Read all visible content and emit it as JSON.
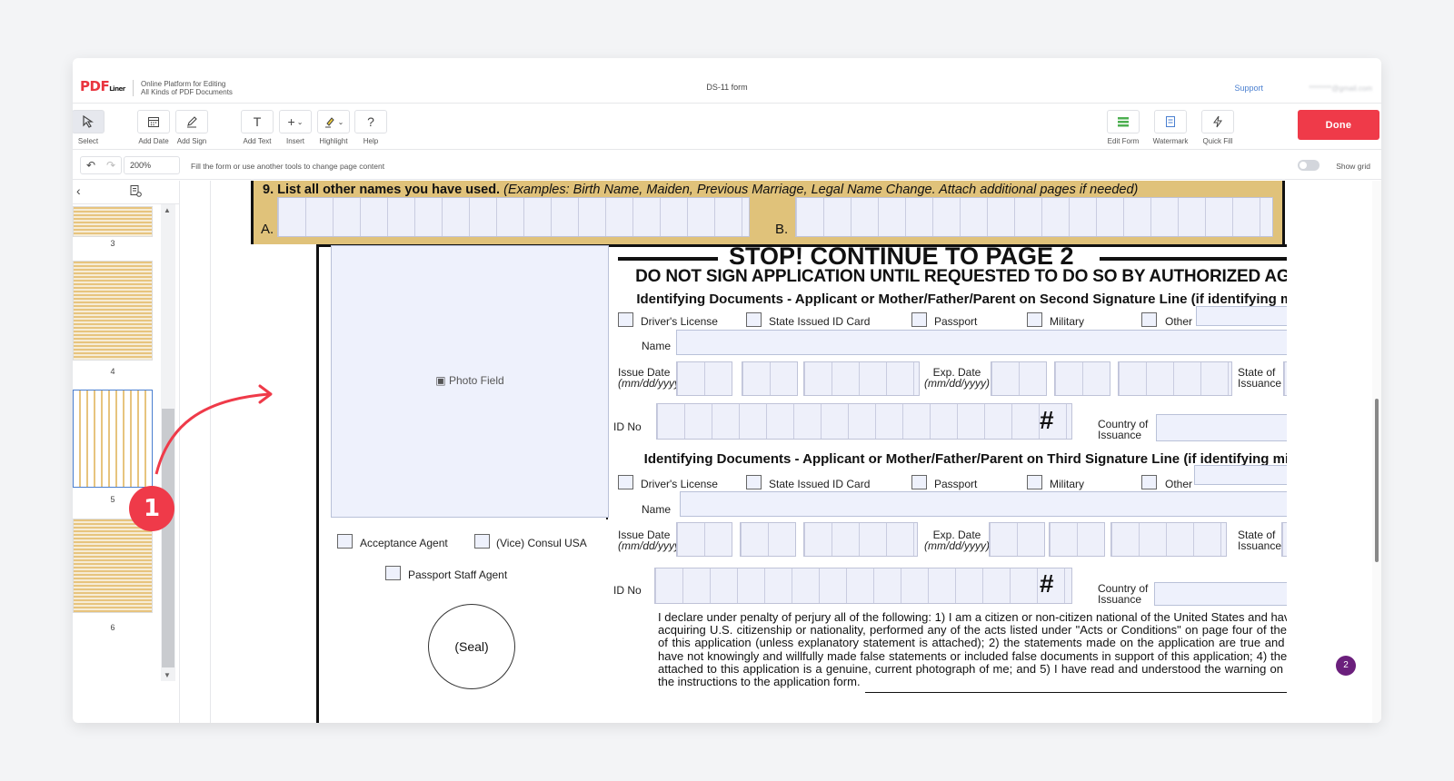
{
  "header": {
    "logo": "PDF",
    "logo_sub": "Liner",
    "tagline_1": "Online Platform for Editing",
    "tagline_2": "All Kinds of PDF Documents",
    "doc_title": "DS-11 form",
    "support": "Support",
    "email": "********@gmail.com"
  },
  "toolbar": {
    "tools": [
      {
        "label": "Select",
        "icon": "cursor-icon"
      },
      {
        "label": "Add Date",
        "icon": "calendar-icon"
      },
      {
        "label": "Add Sign",
        "icon": "pen-icon"
      },
      {
        "label": "Add Text",
        "icon": "text-icon"
      },
      {
        "label": "Insert",
        "icon": "plus-icon"
      },
      {
        "label": "Highlight",
        "icon": "highlighter-icon"
      },
      {
        "label": "Help",
        "icon": "help-icon"
      },
      {
        "label": "Edit Form",
        "icon": "form-icon"
      },
      {
        "label": "Watermark",
        "icon": "watermark-icon"
      },
      {
        "label": "Quick Fill",
        "icon": "lightning-icon"
      }
    ],
    "done_label": "Done"
  },
  "subbar": {
    "zoom": "200%",
    "hint": "Fill the form or use another tools to change page content",
    "show_grid": "Show grid"
  },
  "thumbnails": [
    {
      "page": "3"
    },
    {
      "page": "4"
    },
    {
      "page": "5",
      "active": true
    },
    {
      "page": "6"
    }
  ],
  "current_page_badge": "2",
  "callout_number": "1",
  "form": {
    "q9": {
      "title": "9.  List all other names you have used.",
      "examples": " (Examples: Birth Name, Maiden, Previous Marriage, Legal Name Change.  Attach additional  pages if needed)",
      "label_a": "A.",
      "label_b": "B."
    },
    "photo_field": "Photo Field",
    "stop": "STOP! CONTINUE TO PAGE 2",
    "do_not_sign": "DO NOT SIGN APPLICATION UNTIL REQUESTED TO DO SO BY AUTHORIZED AGENT",
    "id_heading_2": "Identifying Documents - Applicant or Mother/Father/Parent on Second Signature Line (if identifying minor)",
    "id_heading_3": "Identifying Documents - Applicant or Mother/Father/Parent on Third Signature Line (if identifying minor)",
    "doc_types": [
      "Driver's License",
      "State Issued ID Card",
      "Passport",
      "Military",
      "Other"
    ],
    "name_label": "Name",
    "issue_date": "Issue Date",
    "exp_date": "Exp. Date",
    "date_fmt": "(mm/dd/yyyy)",
    "state_of": "State of",
    "issuance": "Issuance",
    "id_no": "ID No",
    "country_of": "Country of",
    "hash": "#",
    "acceptance_agent": "Acceptance Agent",
    "vice_consul": "(Vice) Consul USA",
    "passport_staff": "Passport Staff Agent",
    "seal": "(Seal)",
    "declaration": "I declare under penalty of perjury all of the following: 1) I am a citizen or non-citizen national of the United States and have not, since acquiring U.S. citizenship or nationality, performed any of the acts listed under \"Acts or Conditions\" on page four of the instructions of this application (unless explanatory statement is attached); 2) the statements made on the application are true and correct; 3) I have not knowingly and willfully made false statements or included false documents in support of this application; 4) the photograph attached to this application is a genuine, current photograph of me; and 5) I have read and understood the warning on page one of the instructions to the application form."
  },
  "colors": {
    "accent": "#ef3a49",
    "link": "#4a7fd0",
    "field_fill": "#eef1fc",
    "section_bg": "#e0c27a",
    "badge": "#6b1f7c"
  }
}
